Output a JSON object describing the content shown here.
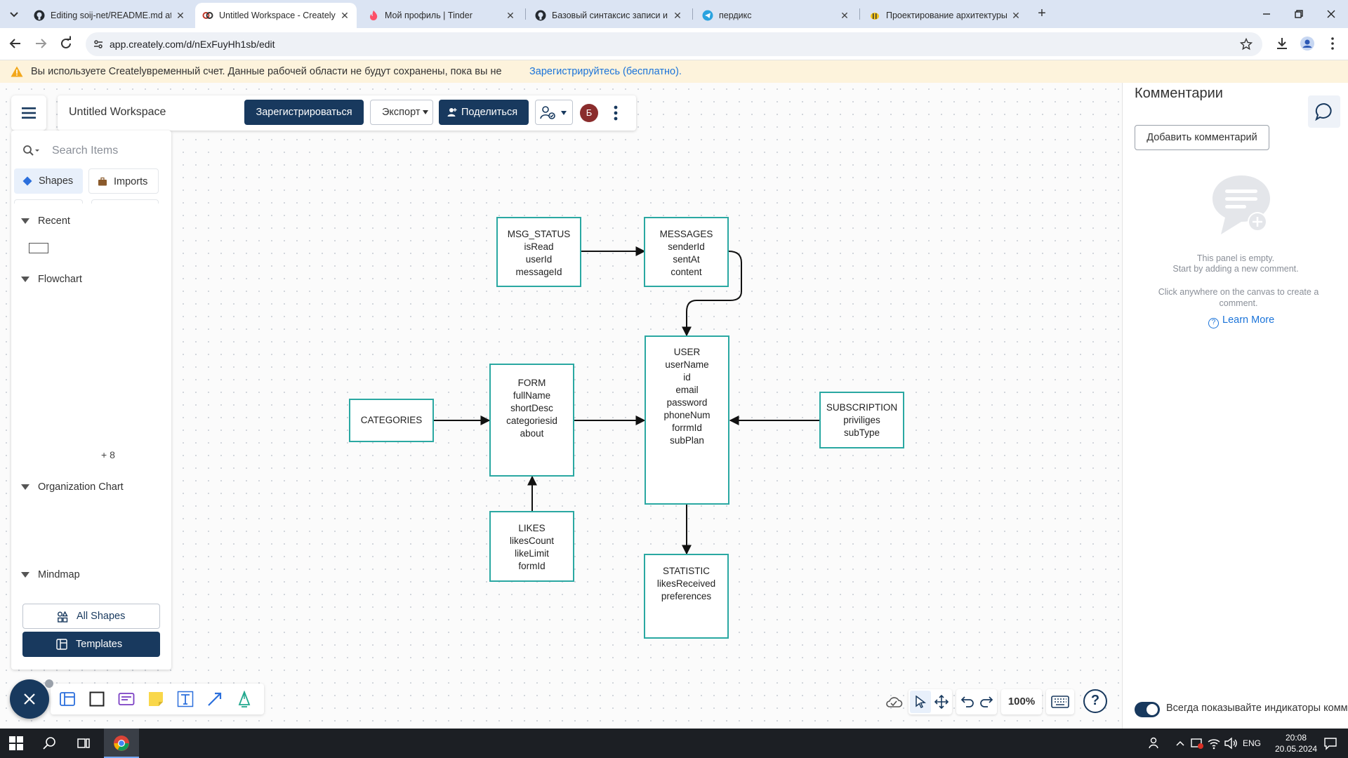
{
  "browser": {
    "tabs": [
      {
        "label": "Editing soij-net/README.md at",
        "icon": "github-icon"
      },
      {
        "label": "Untitled Workspace - Creately",
        "icon": "creately-icon",
        "active": true
      },
      {
        "label": "Мой профиль | Tinder",
        "icon": "tinder-icon"
      },
      {
        "label": "Базовый синтаксис записи и ф",
        "icon": "github-icon"
      },
      {
        "label": "пердикс",
        "icon": "telegram-icon"
      },
      {
        "label": "Проектирование архитектуры",
        "icon": "bee-icon"
      }
    ],
    "url": "app.creately.com/d/nExFuyHh1sb/edit"
  },
  "banner": {
    "message": "Вы используете Createlyвременный счет. Данные рабочей области не будут сохранены, пока вы не",
    "link": "Зарегистрируйтесь (бесплатно)."
  },
  "toolbar": {
    "workspace_title": "Untitled Workspace",
    "register_label": "Зарегистрироваться",
    "export_label": "Экспорт",
    "share_label": "Поделиться",
    "avatar_initial": "Б"
  },
  "left_panel": {
    "search_placeholder": "Search Items",
    "tabs": {
      "shapes": "Shapes",
      "imports": "Imports"
    },
    "sections": {
      "recent": "Recent",
      "flowchart": "Flowchart",
      "more_count": "+ 8",
      "org_chart": "Organization Chart",
      "mindmap": "Mindmap"
    },
    "all_shapes_label": "All Shapes",
    "templates_label": "Templates"
  },
  "zoom": "100%",
  "diagram": {
    "msg_status": [
      "MSG_STATUS",
      "isRead",
      "userId",
      "messageId"
    ],
    "messages": [
      "MESSAGES",
      "senderId",
      "sentAt",
      "content"
    ],
    "user": [
      "USER",
      "userName",
      "id",
      "email",
      "password",
      "phoneNum",
      "forrmId",
      "subPlan"
    ],
    "form": [
      "FORM",
      "fullName",
      "shortDesc",
      "categoriesid",
      "about"
    ],
    "categories": [
      "CATEGORIES"
    ],
    "subscription": [
      "SUBSCRIPTION",
      "priviliges",
      "subType"
    ],
    "likes": [
      "LIKES",
      "likesCount",
      "likeLimit",
      "formId"
    ],
    "statistic": [
      "STATISTIC",
      "likesReceived",
      "preferences"
    ]
  },
  "comments": {
    "title": "Комментарии",
    "add_label": "Добавить комментарий",
    "empty_line1": "This panel is empty.",
    "empty_line2": "Start by adding a new comment.",
    "empty_hint": "Click anywhere on the canvas to create a comment.",
    "learn_more": "Learn More",
    "toggle_label": "Всегда показывайте индикаторы комм"
  },
  "taskbar": {
    "lang": "ENG",
    "time": "20:08",
    "date": "20.05.2024"
  },
  "colors": {
    "primary": "#18395e",
    "node_border": "#2aa8a2",
    "link": "#1a73d9",
    "banner_bg": "#fdf3dc"
  }
}
